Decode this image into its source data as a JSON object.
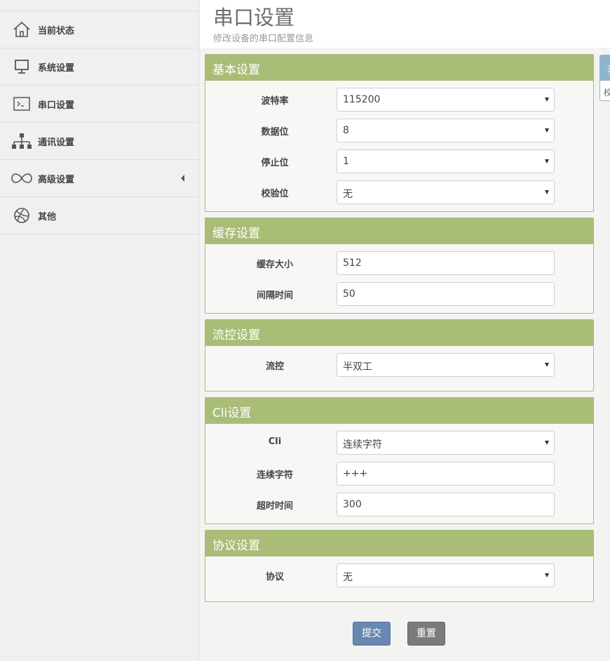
{
  "sidebar": {
    "items": [
      {
        "label": "当前状态",
        "icon": "home-icon"
      },
      {
        "label": "系统设置",
        "icon": "monitor-icon"
      },
      {
        "label": "串口设置",
        "icon": "terminal-icon"
      },
      {
        "label": "通讯设置",
        "icon": "network-icon"
      },
      {
        "label": "高级设置",
        "icon": "infinity-icon"
      },
      {
        "label": "其他",
        "icon": "dribbble-icon"
      }
    ]
  },
  "header": {
    "title": "串口设置",
    "subtitle": "修改设备的串口配置信息"
  },
  "side_panel": {
    "heading": "表",
    "body": "校"
  },
  "panels": {
    "basic": {
      "heading": "基本设置",
      "baud_label": "波特率",
      "baud_value": "115200",
      "databits_label": "数据位",
      "databits_value": "8",
      "stopbits_label": "停止位",
      "stopbits_value": "1",
      "parity_label": "校验位",
      "parity_value": "无"
    },
    "buffer": {
      "heading": "缓存设置",
      "size_label": "缓存大小",
      "size_value": "512",
      "interval_label": "间隔时间",
      "interval_value": "50"
    },
    "flow": {
      "heading": "流控设置",
      "flow_label": "流控",
      "flow_value": "半双工"
    },
    "cli": {
      "heading": "Cli设置",
      "cli_label": "Cli",
      "cli_value": "连续字符",
      "chars_label": "连续字符",
      "chars_value": "+++",
      "timeout_label": "超时时间",
      "timeout_value": "300"
    },
    "protocol": {
      "heading": "协议设置",
      "protocol_label": "协议",
      "protocol_value": "无"
    }
  },
  "buttons": {
    "submit": "提交",
    "reset": "重置"
  },
  "colors": {
    "panel_header": "#a9bd77",
    "submit_button": "#6788b0",
    "reset_button": "#7b7b7b",
    "side_panel": "#8fb4cf"
  }
}
